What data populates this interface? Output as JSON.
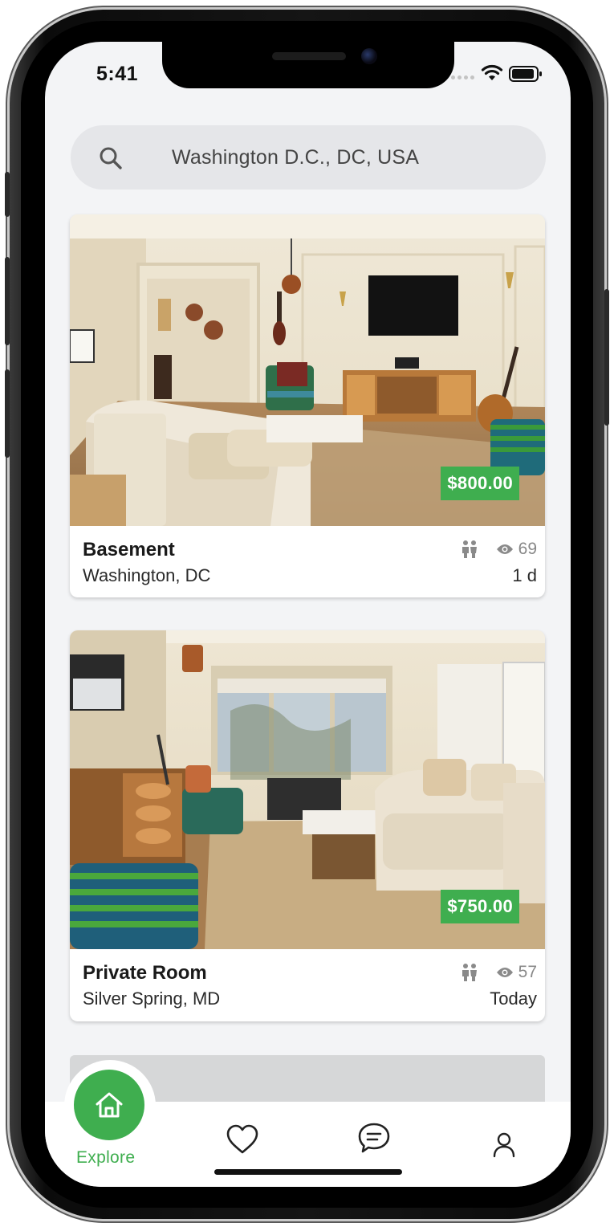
{
  "status_bar": {
    "time": "5:41"
  },
  "search": {
    "value": "Washington D.C., DC, USA",
    "icon": "search-icon"
  },
  "listings": [
    {
      "title": "Basement",
      "location": "Washington, DC",
      "price": "$800.00",
      "views": "69",
      "age": "1 d"
    },
    {
      "title": "Private Room",
      "location": "Silver Spring, MD",
      "price": "$750.00",
      "views": "57",
      "age": "Today"
    }
  ],
  "nav": {
    "active_label": "Explore",
    "items": [
      {
        "name": "explore",
        "icon": "home-icon"
      },
      {
        "name": "favorites",
        "icon": "heart-icon"
      },
      {
        "name": "messages",
        "icon": "chat-icon"
      },
      {
        "name": "profile",
        "icon": "user-icon"
      }
    ]
  },
  "colors": {
    "accent": "#3fae4f",
    "background": "#f3f4f6"
  }
}
